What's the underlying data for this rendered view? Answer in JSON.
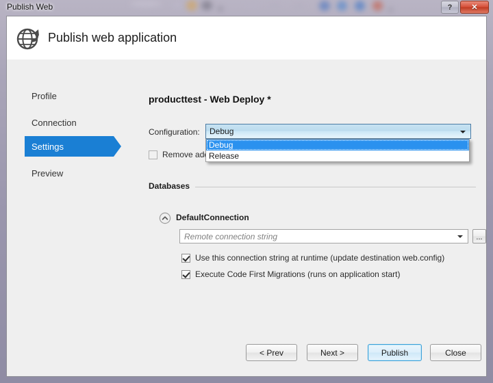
{
  "window": {
    "title": "Publish Web",
    "help_button_label": "?",
    "close_button_label": "✕"
  },
  "header": {
    "title": "Publish web application",
    "icon": "globe-publish-icon"
  },
  "sidebar": {
    "items": [
      {
        "label": "Profile",
        "selected": false
      },
      {
        "label": "Connection",
        "selected": false
      },
      {
        "label": "Settings",
        "selected": true
      },
      {
        "label": "Preview",
        "selected": false
      }
    ],
    "selected_color": "#1a7fd4"
  },
  "main": {
    "profile_title": "producttest - Web Deploy *",
    "configuration": {
      "label": "Configuration:",
      "value": "Debug",
      "expanded": true,
      "options": [
        {
          "label": "Debug",
          "highlighted": true
        },
        {
          "label": "Release",
          "highlighted": false
        }
      ],
      "dropdown_arrow_icon": "chevron-down-icon"
    },
    "remove_additional_files": {
      "label": "Remove additional files at destination",
      "checked": false,
      "disabled": true
    },
    "databases": {
      "group_label": "Databases",
      "connection": {
        "name": "DefaultConnection",
        "collapse_icon": "chevron-up-circle-icon",
        "connection_string_value": "",
        "connection_string_placeholder": "Remote connection string",
        "browse_button_label": "...",
        "dropdown_arrow_icon": "chevron-down-icon",
        "options": [
          {
            "label": "Use this connection string at runtime (update destination web.config)",
            "checked": true
          },
          {
            "label": "Execute Code First Migrations (runs on application start)",
            "checked": true
          }
        ]
      }
    }
  },
  "footer": {
    "buttons": [
      {
        "label": "< Prev",
        "default": false
      },
      {
        "label": "Next >",
        "default": false
      },
      {
        "label": "Publish",
        "default": true
      },
      {
        "label": "Close",
        "default": false
      }
    ]
  }
}
